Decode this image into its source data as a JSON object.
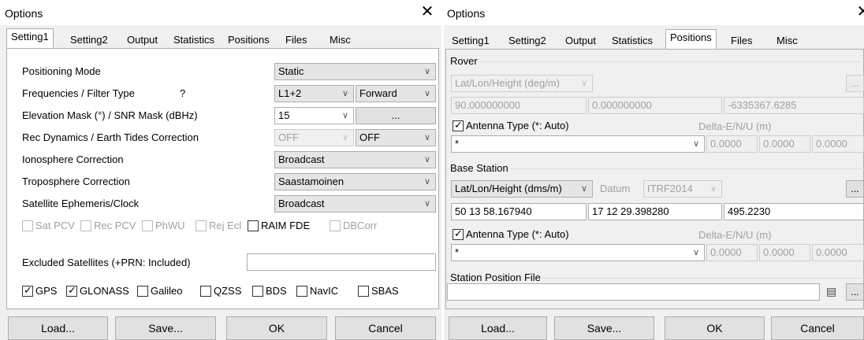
{
  "left": {
    "title": "Options",
    "close": "✕",
    "tabs": [
      "Setting1",
      "Setting2",
      "Output",
      "Statistics",
      "Positions",
      "Files",
      "Misc"
    ],
    "active_tab": "Setting1",
    "rows": {
      "positioning_mode": {
        "label": "Positioning Mode",
        "value": "Static"
      },
      "frequencies": {
        "label": "Frequencies / Filter Type",
        "help": "?",
        "value": "L1+2",
        "value2": "Forward"
      },
      "elevation": {
        "label": "Elevation Mask (°) / SNR Mask (dBHz)",
        "value": "15",
        "button": "..."
      },
      "rec_dynamics": {
        "label": "Rec Dynamics / Earth Tides Correction",
        "value": "OFF",
        "value2": "OFF"
      },
      "ionosphere": {
        "label": "Ionosphere Correction",
        "value": "Broadcast"
      },
      "troposphere": {
        "label": "Troposphere Correction",
        "value": "Saastamoinen"
      },
      "ephemeris": {
        "label": "Satellite Ephemeris/Clock",
        "value": "Broadcast"
      }
    },
    "options_checks": [
      {
        "label": "Sat PCV",
        "checked": false,
        "enabled": false
      },
      {
        "label": "Rec PCV",
        "checked": false,
        "enabled": false
      },
      {
        "label": "PhWU",
        "checked": false,
        "enabled": false
      },
      {
        "label": "Rej Ecl",
        "checked": false,
        "enabled": false
      },
      {
        "label": "RAIM FDE",
        "checked": false,
        "enabled": true
      },
      {
        "label": "DBCorr",
        "checked": false,
        "enabled": false
      }
    ],
    "excluded_label": "Excluded Satellites (+PRN: Included)",
    "excluded_value": "",
    "systems": [
      {
        "label": "GPS",
        "checked": true
      },
      {
        "label": "GLONASS",
        "checked": true
      },
      {
        "label": "Galileo",
        "checked": false
      },
      {
        "label": "QZSS",
        "checked": false
      },
      {
        "label": "BDS",
        "checked": false
      },
      {
        "label": "NavIC",
        "checked": false
      },
      {
        "label": "SBAS",
        "checked": false
      }
    ],
    "buttons": {
      "load": "Load...",
      "save": "Save...",
      "ok": "OK",
      "cancel": "Cancel"
    }
  },
  "right": {
    "title": "Options",
    "close": "✕",
    "tabs": [
      "Setting1",
      "Setting2",
      "Output",
      "Statistics",
      "Positions",
      "Files",
      "Misc"
    ],
    "active_tab": "Positions",
    "rover": {
      "group_title": "Rover",
      "format": "Lat/Lon/Height (deg/m)",
      "button": "...",
      "lat": "90.000000000",
      "lon": "0.000000000",
      "height": "-6335367.6285",
      "antenna_checked": true,
      "antenna_label": "Antenna Type (*: Auto)",
      "delta_label": "Delta-E/N/U (m)",
      "antenna_value": "*",
      "delta_e": "0.0000",
      "delta_n": "0.0000",
      "delta_u": "0.0000"
    },
    "base": {
      "group_title": "Base Station",
      "format": "Lat/Lon/Height (dms/m)",
      "datum_label": "Datum",
      "datum_value": "ITRF2014",
      "button": "...",
      "lat": "50 13 58.167940",
      "lon": "17 12 29.398280",
      "height": "495.2230",
      "antenna_checked": true,
      "antenna_label": "Antenna Type (*: Auto)",
      "delta_label": "Delta-E/N/U (m)",
      "antenna_value": "*",
      "delta_e": "0.0000",
      "delta_n": "0.0000",
      "delta_u": "0.0000"
    },
    "station_file": {
      "label": "Station Position File",
      "value": "",
      "button": "..."
    },
    "buttons": {
      "load": "Load...",
      "save": "Save...",
      "ok": "OK",
      "cancel": "Cancel"
    }
  },
  "colors": {
    "panel": "#f0f0f0",
    "page": "#ffffff",
    "border": "#adadad",
    "disabled_text": "#a0a0a0"
  },
  "icons": {
    "close": "close-icon",
    "dropdown": "chevron-down-icon",
    "check": "checkmark-icon",
    "list": "list-icon"
  }
}
